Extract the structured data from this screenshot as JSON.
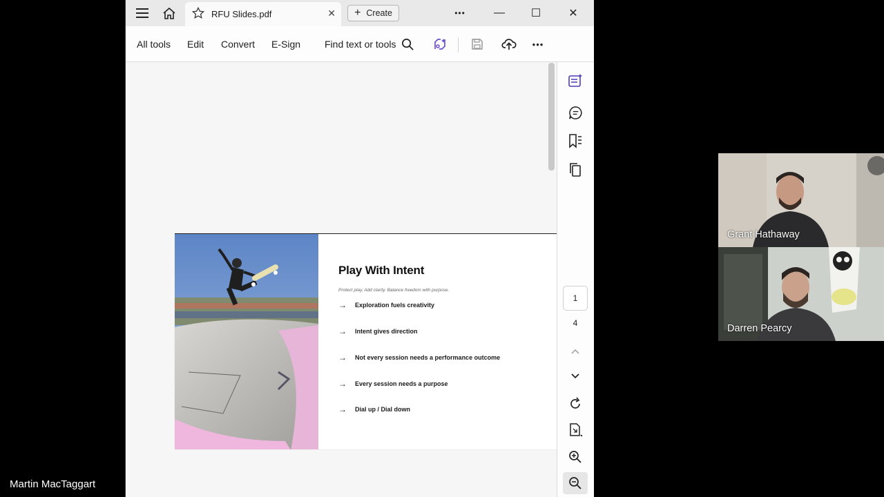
{
  "window": {
    "tab_title": "RFU Slides.pdf",
    "tab_close": "✕",
    "create_label": "Create",
    "more_label": "•••",
    "minimize": "—",
    "maximize": "☐",
    "close": "✕"
  },
  "toolbar": {
    "menus": [
      "All tools",
      "Edit",
      "Convert",
      "E-Sign"
    ],
    "find_label": "Find text or tools",
    "more_label": "•••"
  },
  "slide": {
    "title": "Play With Intent",
    "subtitle": "Protect play. Add clarity. Balance freedom with purpose.",
    "bullets": [
      "Exploration fuels creativity",
      "Intent gives direction",
      "Not every session needs a performance outcome",
      "Every session needs a purpose",
      "Dial up / Dial down"
    ]
  },
  "navigation": {
    "current_page": "1",
    "total_pages": "4"
  },
  "participants": [
    {
      "name": "Grant Hathaway"
    },
    {
      "name": "Darren Pearcy"
    }
  ],
  "self_name": "Martin MacTaggart",
  "colors": {
    "accent": "#6b4fd1",
    "window_bg": "#f6f6f6",
    "titlebar_bg": "#e9e9e9"
  }
}
